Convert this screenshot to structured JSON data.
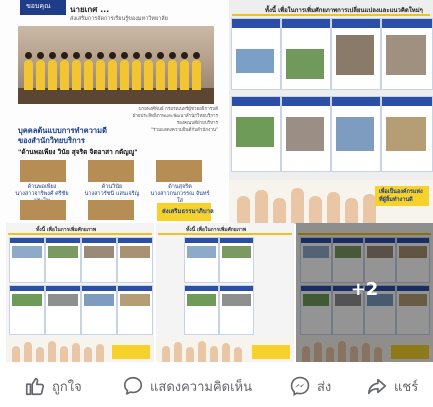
{
  "tile1": {
    "tag": "ขอบคุณ",
    "header": "นายเกศ ...",
    "subtitle": "ส่งเสริมการจัดการเรียนรู้ของมหาวิทยาลัย",
    "caption_lines": [
      "นายพงศ์พันธ์ กรมรณนทร์ผู้ช่วยอธิการบดี",
      "ฝ่ายประสิทธิภาพและพัฒนาสำนักวิทยบริการ",
      "รองคณบดีฝ่ายบริหาร",
      "\"ร่วมแสดงความยินดีกับสำนักงาน\""
    ],
    "title_lines": [
      "บุคคลต้นแบบการทำความดี",
      "ของสำนักวิทยบริการ"
    ],
    "names": "\"ด้านพอเพียง วินัย สุจริต จิตอาสา กตัญญู\"",
    "cap_left": [
      "ด้านพอเพียง",
      "นางสาวจาริพงศ์ ศรีชัยประไพ"
    ],
    "cap_mid": [
      "ด้านวินัย",
      "นางสาวรัชนี แสนเจริญ"
    ],
    "cap_right": [
      "ด้านสุจริต",
      "นางสาวกนกวรรณ จันทร์ใส"
    ],
    "note": "ส่งเสริมธรรมาภิบาล"
  },
  "tile2": {
    "header": "ทั้งนี้ เพื่อในการเพิ่มศักยภาพการเปลี่ยนแปลงและแนวคิดใหม่ๆ",
    "note": "เพื่อเป็นองค์กรแห่ง ที่ผู้ลิ้มทำงานดี"
  },
  "tile3": {
    "header": "ทั้งนี้ เพื่อในการเพิ่มศักยภาพ"
  },
  "tile4": {
    "header": "ทั้งนี้ เพื่อในการเพิ่มศักยภาพ"
  },
  "tile5": {
    "more_count": "+2"
  },
  "actions": {
    "like": "ถูกใจ",
    "comment": "แสดงความคิดเห็น",
    "send": "ส่ง",
    "share": "แชร์"
  },
  "colors": {
    "brand_blue": "#1f3c88",
    "highlight_yellow": "#f6d22b",
    "action_gray": "#65676b"
  }
}
